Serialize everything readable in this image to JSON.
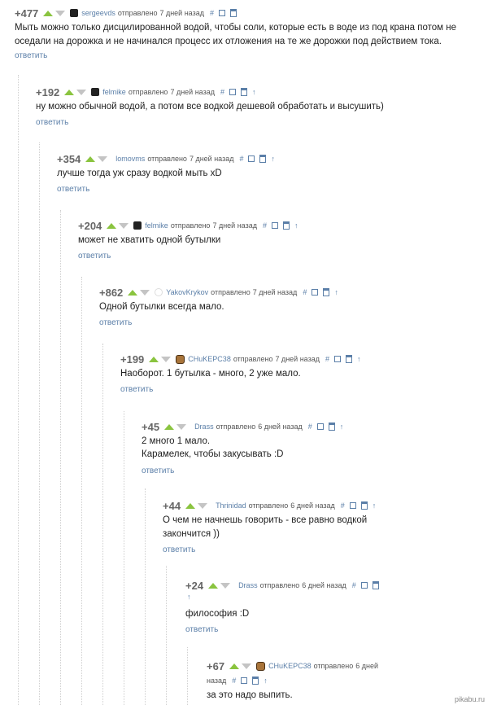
{
  "comments": [
    {
      "score": "+477",
      "author": "sergeevds",
      "sent": "отправлено",
      "time": "7 дней назад",
      "text": "Мыть можно только дисцилированной водой, чтобы соли, которые есть в воде из под крана потом не оседали на дорожка и не начинался процесс их отложения на те же дорожки под действием тока.",
      "reply": "ответить"
    },
    {
      "score": "+192",
      "author": "felmike",
      "sent": "отправлено",
      "time": "7 дней назад",
      "text": "ну можно обычной водой, а потом все водкой дешевой обработать и высушить)",
      "reply": "ответить"
    },
    {
      "score": "+354",
      "author": "lomovms",
      "sent": "отправлено",
      "time": "7 дней назад",
      "text": "лучше тогда уж сразу водкой мыть xD",
      "reply": "ответить"
    },
    {
      "score": "+204",
      "author": "felmike",
      "sent": "отправлено",
      "time": "7 дней назад",
      "text": "может не хватить одной бутылки",
      "reply": "ответить"
    },
    {
      "score": "+862",
      "author": "YakovKrykov",
      "sent": "отправлено",
      "time": "7 дней назад",
      "text": "Одной бутылки всегда мало.",
      "reply": "ответить"
    },
    {
      "score": "+199",
      "author": "CHuKEPC38",
      "sent": "отправлено",
      "time": "7 дней назад",
      "text": "Наоборот. 1 бутылка - много, 2 уже мало.",
      "reply": "ответить"
    },
    {
      "score": "+45",
      "author": "Drass",
      "sent": "отправлено",
      "time": "6 дней назад",
      "text": "2 много 1 мало.",
      "text2": "Карамелек, чтобы закусывать :D",
      "reply": "ответить"
    },
    {
      "score": "+44",
      "author": "Thrinidad",
      "sent": "отправлено",
      "time": "6 дней назад",
      "text": "О чем не начнешь говорить - все равно водкой",
      "text2": "закончится ))",
      "reply": "ответить"
    },
    {
      "score": "+24",
      "author": "Drass",
      "sent": "отправлено",
      "time": "6 дней назад",
      "text": "философия :D",
      "reply": "ответить"
    },
    {
      "score": "+67",
      "author": "CHuKEPC38",
      "sent": "отправлено",
      "time": "6 дней",
      "time2": "назад",
      "text": "за это надо выпить."
    }
  ],
  "icons": {
    "hash": "#",
    "arrow": "↑"
  },
  "watermark": "pikabu.ru"
}
